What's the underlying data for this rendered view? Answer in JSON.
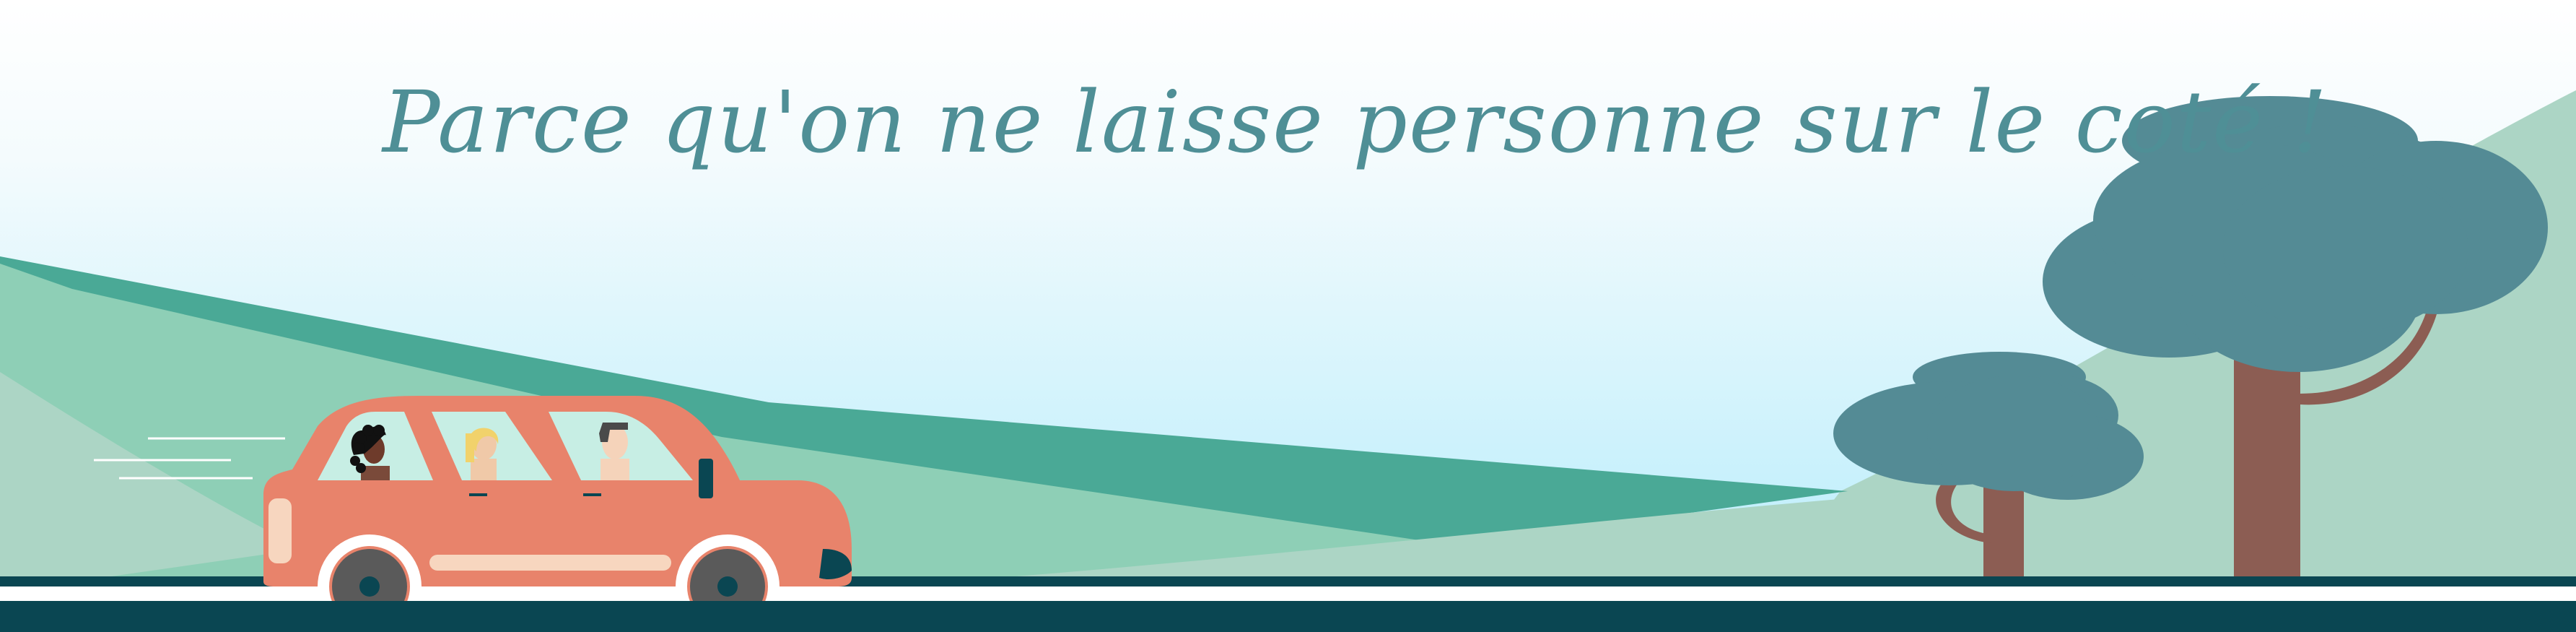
{
  "banner": {
    "tagline": "Parce qu'on ne laisse personne sur le coté !"
  },
  "colors": {
    "sky_top": "#ffffff",
    "sky_bottom": "#b4ecfb",
    "hill_dark": "#4aa996",
    "hill_light": "#8ecfb6",
    "hill_pale": "#acd5c5",
    "road": "#0a4652",
    "road_stripe": "#ffffff",
    "car_body": "#e8836b",
    "car_window": "#c7eee4",
    "tree_canopy": "#548b95",
    "tree_trunk": "#8c5d53",
    "tagline": "#4f8f96"
  },
  "icons": [
    "car-icon",
    "tree-icon",
    "motion-lines-icon"
  ]
}
